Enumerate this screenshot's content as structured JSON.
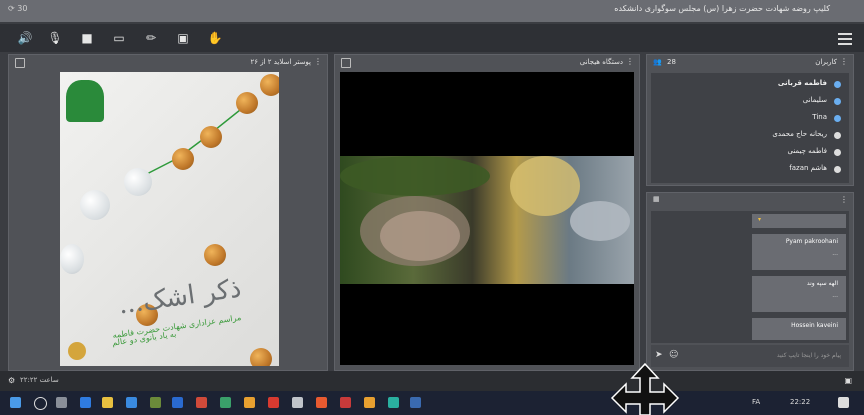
{
  "titlebar": {
    "title": "کلیپ روضه شهادت حضرت زهرا (س) مجلس سوگواری دانشکده",
    "left_text": "⟳ 30"
  },
  "toolbar": {
    "icons": [
      "speaker-icon",
      "mic-off-icon",
      "camera-icon",
      "screen-icon",
      "pen-icon",
      "whiteboard-icon",
      "hand-icon"
    ]
  },
  "presentation": {
    "title": "پوستر اسلاید ۲ از ۲۶"
  },
  "poster": {
    "title": "ذکر اشک...",
    "line1": "مراسم عزاداری شهادت حضرت فاطمه",
    "line2": "به یاد بانوی دو عالم"
  },
  "video": {
    "title": "دستگاه هیجانی"
  },
  "attendees": {
    "count": "28",
    "title": "کاربران",
    "list": [
      "فاطمه قربانی",
      "سلیمانی",
      "Tina",
      "ریحانه حاج محمدی",
      "فاطمه چیمنی",
      "هاشم fazan"
    ]
  },
  "chat": {
    "messages": [
      {
        "name": "",
        "text": "▾"
      },
      {
        "name": "Pyam pakroohani",
        "text": "..."
      },
      {
        "name": "الهه سپه وند",
        "text": "..."
      },
      {
        "name": "Hossein kaveini",
        "text": ""
      }
    ],
    "input_placeholder": "پیام خود را اینجا تایپ کنید"
  },
  "statusbar": {
    "text": "ساعت ۲۲:۲۲"
  },
  "taskbar": {
    "clock": "22:22",
    "lang": "FA"
  }
}
